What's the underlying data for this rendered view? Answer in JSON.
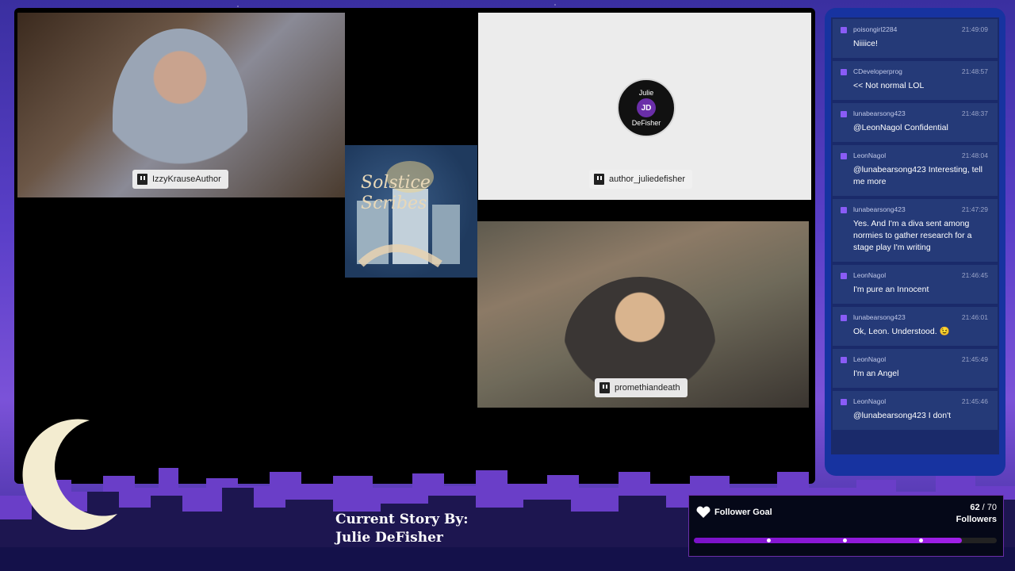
{
  "cams": {
    "cam1_name": "IzzyKrauseAuthor",
    "cam2_name": "author_juliedefisher",
    "cam3_name": "promethiandeath",
    "avatar_line1": "Julie",
    "avatar_mono": "JD",
    "avatar_line2": "DeFisher"
  },
  "logo": {
    "text": "Solstice Scribes"
  },
  "chat": {
    "messages": [
      {
        "user": "poisongirl2284",
        "time": "21:49:09",
        "text": "Niiiice!"
      },
      {
        "user": "CDeveloperprog",
        "time": "21:48:57",
        "text": "<< Not normal LOL"
      },
      {
        "user": "lunabearsong423",
        "time": "21:48:37",
        "text": "@LeonNagol Confidential"
      },
      {
        "user": "LeonNagol",
        "time": "21:48:04",
        "text": "@lunabearsong423 Interesting, tell me more"
      },
      {
        "user": "lunabearsong423",
        "time": "21:47:29",
        "text": "Yes. And I'm a diva sent among normies to gather research for a stage play I'm writing"
      },
      {
        "user": "LeonNagol",
        "time": "21:46:45",
        "text": "I'm pure an Innocent"
      },
      {
        "user": "lunabearsong423",
        "time": "21:46:01",
        "text": "Ok, Leon. Understood. 😉"
      },
      {
        "user": "LeonNagol",
        "time": "21:45:49",
        "text": "I'm an Angel"
      },
      {
        "user": "LeonNagol",
        "time": "21:45:46",
        "text": "@lunabearsong423 I don't"
      }
    ]
  },
  "story": {
    "line1": "Current Story By:",
    "line2": "Julie DeFisher"
  },
  "goal": {
    "title": "Follower Goal",
    "current": "62",
    "target": "70",
    "unit": "Followers",
    "progress": 0.886
  },
  "colors": {
    "chat_panel": "#1733a0",
    "goal_fill": "#a020e8"
  }
}
